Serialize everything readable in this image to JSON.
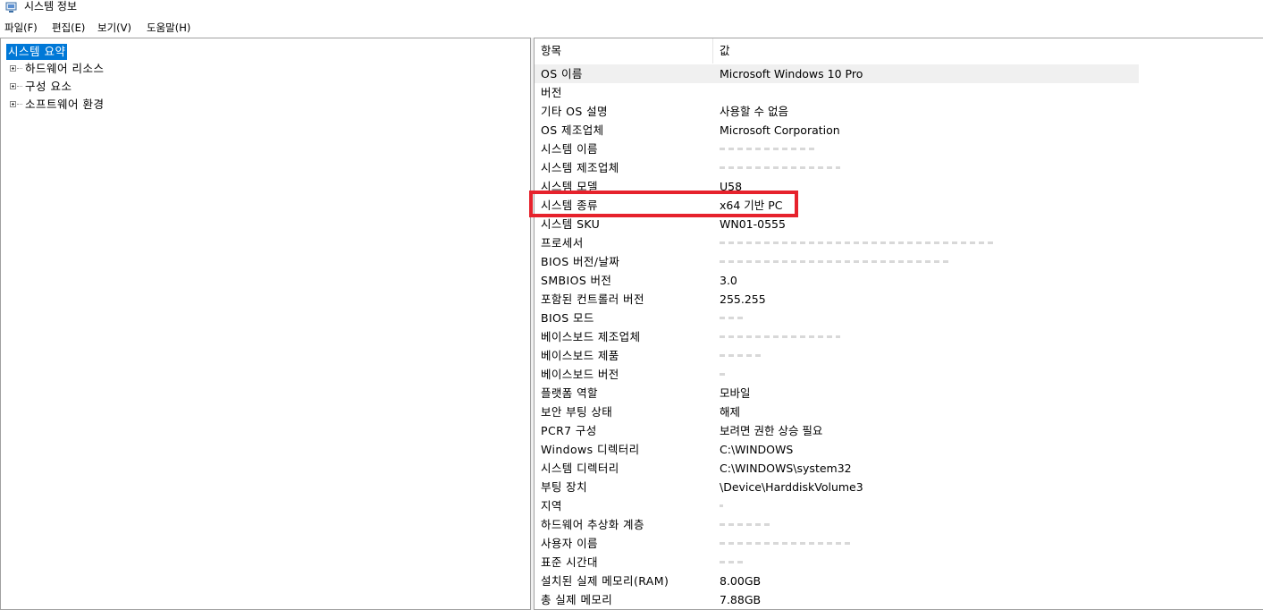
{
  "window": {
    "title": "시스템 정보"
  },
  "menu": [
    {
      "label": "파일(F)"
    },
    {
      "label": "편집(E)"
    },
    {
      "label": "보기(V)"
    },
    {
      "label": "도움말(H)"
    }
  ],
  "tree": {
    "root": "시스템 요약",
    "children": [
      {
        "label": "하드웨어 리소스"
      },
      {
        "label": "구성 요소"
      },
      {
        "label": "소프트웨어 환경"
      }
    ]
  },
  "table": {
    "columns": {
      "item": "항목",
      "value": "값"
    },
    "rows": [
      {
        "item": "OS 이름",
        "value": "Microsoft Windows 10 Pro"
      },
      {
        "item": "버전",
        "value": ""
      },
      {
        "item": "기타 OS 설명",
        "value": "사용할 수 없음"
      },
      {
        "item": "OS 제조업체",
        "value": "Microsoft Corporation"
      },
      {
        "item": "시스템 이름",
        "value": ""
      },
      {
        "item": "시스템 제조업체",
        "value": ""
      },
      {
        "item": "시스템 모델",
        "value": "U58"
      },
      {
        "item": "시스템 종류",
        "value": "x64 기반 PC"
      },
      {
        "item": "시스템 SKU",
        "value": "WN01-0555"
      },
      {
        "item": "프로세서",
        "value": ""
      },
      {
        "item": "BIOS 버전/날짜",
        "value": ""
      },
      {
        "item": "SMBIOS 버전",
        "value": "3.0"
      },
      {
        "item": "포함된 컨트롤러 버전",
        "value": "255.255"
      },
      {
        "item": "BIOS 모드",
        "value": ""
      },
      {
        "item": "베이스보드 제조업체",
        "value": ""
      },
      {
        "item": "베이스보드 제품",
        "value": ""
      },
      {
        "item": "베이스보드 버전",
        "value": ""
      },
      {
        "item": "플랫폼 역할",
        "value": "모바일"
      },
      {
        "item": "보안 부팅 상태",
        "value": "해제"
      },
      {
        "item": "PCR7 구성",
        "value": "보려면 권한 상승 필요"
      },
      {
        "item": "Windows 디렉터리",
        "value": "C:\\WINDOWS"
      },
      {
        "item": "시스템 디렉터리",
        "value": "C:\\WINDOWS\\system32"
      },
      {
        "item": "부팅 장치",
        "value": "\\Device\\HarddiskVolume3"
      },
      {
        "item": "지역",
        "value": ""
      },
      {
        "item": "하드웨어 추상화 계층",
        "value": ""
      },
      {
        "item": "사용자 이름",
        "value": ""
      },
      {
        "item": "표준 시간대",
        "value": ""
      },
      {
        "item": "설치된 실제 메모리(RAM)",
        "value": "8.00GB"
      },
      {
        "item": "총 실제 메모리",
        "value": "7.88GB"
      }
    ]
  },
  "colors": {
    "selection": "#0078d7",
    "highlight_box": "#e6222c",
    "selected_row": "#f0f0f0"
  }
}
